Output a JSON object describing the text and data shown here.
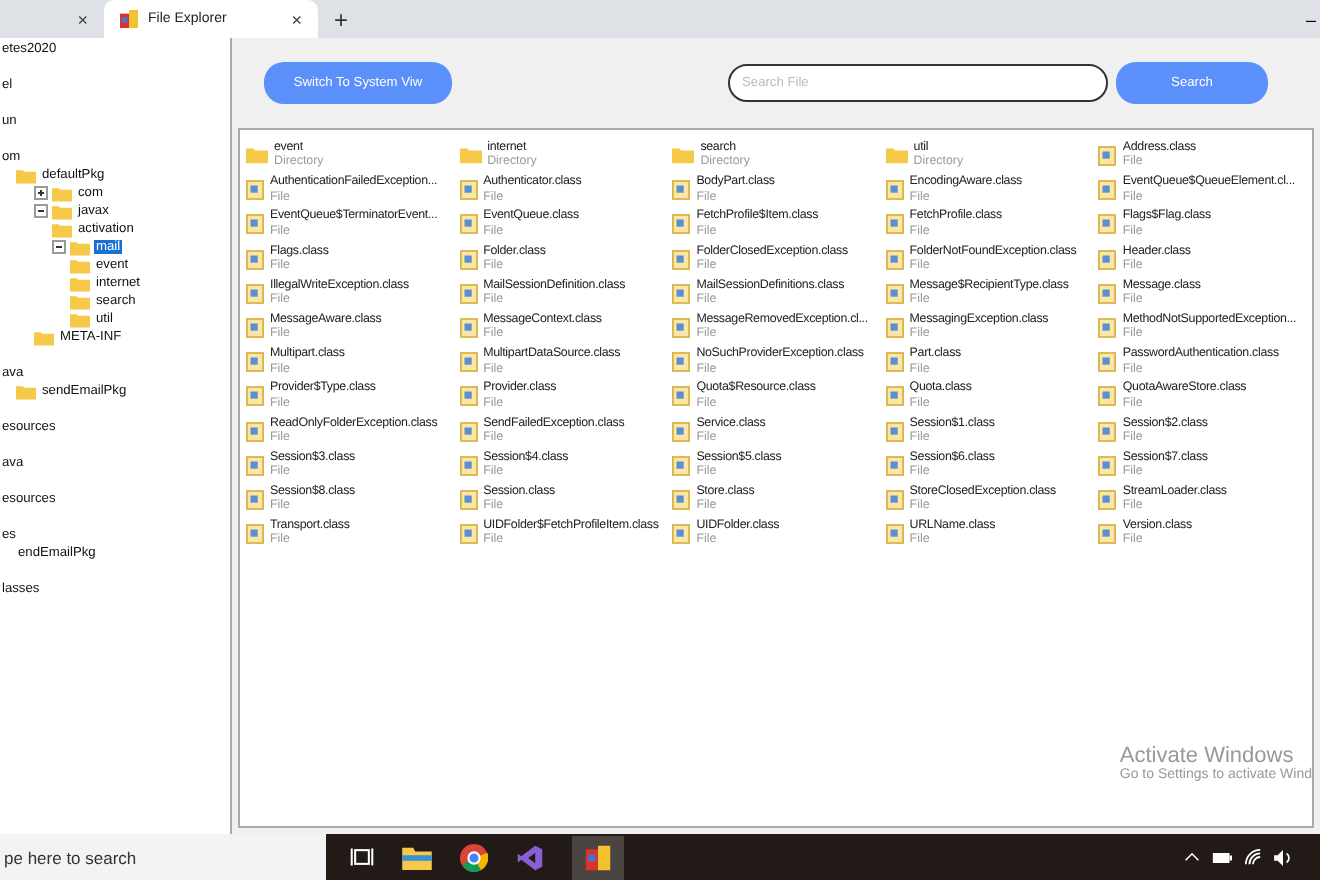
{
  "browser_tabs": [
    {
      "selected": false,
      "close": "×"
    },
    {
      "label": "File Explorer",
      "selected": true,
      "close": "×"
    }
  ],
  "new_tab": "+",
  "window_controls": {
    "minimize": "–"
  },
  "tree": [
    {
      "label": "etes2020",
      "selected": false
    },
    {
      "label": "el",
      "selected": false
    },
    {
      "label": "un",
      "selected": false
    },
    {
      "label": "om",
      "selected": false,
      "children": [
        {
          "label": "defaultPkg",
          "kind": "folder",
          "selected": false,
          "children": [
            {
              "label": "com",
              "kind": "folder",
              "selected": false,
              "expanded": false
            },
            {
              "label": "javax",
              "kind": "folder",
              "selected": false,
              "expanded": true,
              "children": [
                {
                  "label": "activation",
                  "kind": "folder",
                  "selected": false
                },
                {
                  "label": "mail",
                  "kind": "folder",
                  "selected": true,
                  "expanded": true,
                  "children": [
                    {
                      "label": "event",
                      "kind": "folder",
                      "selected": false
                    },
                    {
                      "label": "internet",
                      "kind": "folder",
                      "selected": false
                    },
                    {
                      "label": "search",
                      "kind": "folder",
                      "selected": false
                    },
                    {
                      "label": "util",
                      "kind": "folder",
                      "selected": false
                    }
                  ]
                }
              ]
            },
            {
              "label": "META-INF",
              "kind": "folder",
              "selected": false
            }
          ]
        }
      ]
    },
    {
      "label": "ava",
      "selected": false,
      "children": [
        {
          "label": "sendEmailPkg",
          "kind": "folder",
          "selected": false
        }
      ]
    },
    {
      "label": "esources",
      "selected": false
    },
    {
      "label": "ava",
      "selected": false
    },
    {
      "label": "esources",
      "selected": false
    },
    {
      "label": "es",
      "selected": false,
      "children": [
        {
          "label": "endEmailPkg",
          "selected": false
        }
      ]
    },
    {
      "label": "lasses",
      "selected": false
    }
  ],
  "toolbar": {
    "switch_button": "Switch To System Viw",
    "search": {
      "placeholder": "Search File"
    },
    "search_button": "Search"
  },
  "files": [
    {
      "name": "event",
      "type": "Directory",
      "kind": "directory"
    },
    {
      "name": "internet",
      "type": "Directory",
      "kind": "directory"
    },
    {
      "name": "search",
      "type": "Directory",
      "kind": "directory"
    },
    {
      "name": "util",
      "type": "Directory",
      "kind": "directory"
    },
    {
      "name": "Address.class",
      "type": "File",
      "kind": "file"
    },
    {
      "name": "AuthenticationFailedException...",
      "type": "File",
      "kind": "file"
    },
    {
      "name": "Authenticator.class",
      "type": "File",
      "kind": "file"
    },
    {
      "name": "BodyPart.class",
      "type": "File",
      "kind": "file"
    },
    {
      "name": "EncodingAware.class",
      "type": "File",
      "kind": "file"
    },
    {
      "name": "EventQueue$QueueElement.cl...",
      "type": "File",
      "kind": "file"
    },
    {
      "name": "EventQueue$TerminatorEvent...",
      "type": "File",
      "kind": "file"
    },
    {
      "name": "EventQueue.class",
      "type": "File",
      "kind": "file"
    },
    {
      "name": "FetchProfile$Item.class",
      "type": "File",
      "kind": "file"
    },
    {
      "name": "FetchProfile.class",
      "type": "File",
      "kind": "file"
    },
    {
      "name": "Flags$Flag.class",
      "type": "File",
      "kind": "file"
    },
    {
      "name": "Flags.class",
      "type": "File",
      "kind": "file"
    },
    {
      "name": "Folder.class",
      "type": "File",
      "kind": "file"
    },
    {
      "name": "FolderClosedException.class",
      "type": "File",
      "kind": "file"
    },
    {
      "name": "FolderNotFoundException.class",
      "type": "File",
      "kind": "file"
    },
    {
      "name": "Header.class",
      "type": "File",
      "kind": "file"
    },
    {
      "name": "IllegalWriteException.class",
      "type": "File",
      "kind": "file"
    },
    {
      "name": "MailSessionDefinition.class",
      "type": "File",
      "kind": "file"
    },
    {
      "name": "MailSessionDefinitions.class",
      "type": "File",
      "kind": "file"
    },
    {
      "name": "Message$RecipientType.class",
      "type": "File",
      "kind": "file"
    },
    {
      "name": "Message.class",
      "type": "File",
      "kind": "file"
    },
    {
      "name": "MessageAware.class",
      "type": "File",
      "kind": "file"
    },
    {
      "name": "MessageContext.class",
      "type": "File",
      "kind": "file"
    },
    {
      "name": "MessageRemovedException.cl...",
      "type": "File",
      "kind": "file"
    },
    {
      "name": "MessagingException.class",
      "type": "File",
      "kind": "file"
    },
    {
      "name": "MethodNotSupportedException...",
      "type": "File",
      "kind": "file"
    },
    {
      "name": "Multipart.class",
      "type": "File",
      "kind": "file"
    },
    {
      "name": "MultipartDataSource.class",
      "type": "File",
      "kind": "file"
    },
    {
      "name": "NoSuchProviderException.class",
      "type": "File",
      "kind": "file"
    },
    {
      "name": "Part.class",
      "type": "File",
      "kind": "file"
    },
    {
      "name": "PasswordAuthentication.class",
      "type": "File",
      "kind": "file"
    },
    {
      "name": "Provider$Type.class",
      "type": "File",
      "kind": "file"
    },
    {
      "name": "Provider.class",
      "type": "File",
      "kind": "file"
    },
    {
      "name": "Quota$Resource.class",
      "type": "File",
      "kind": "file"
    },
    {
      "name": "Quota.class",
      "type": "File",
      "kind": "file"
    },
    {
      "name": "QuotaAwareStore.class",
      "type": "File",
      "kind": "file"
    },
    {
      "name": "ReadOnlyFolderException.class",
      "type": "File",
      "kind": "file"
    },
    {
      "name": "SendFailedException.class",
      "type": "File",
      "kind": "file"
    },
    {
      "name": "Service.class",
      "type": "File",
      "kind": "file"
    },
    {
      "name": "Session$1.class",
      "type": "File",
      "kind": "file"
    },
    {
      "name": "Session$2.class",
      "type": "File",
      "kind": "file"
    },
    {
      "name": "Session$3.class",
      "type": "File",
      "kind": "file"
    },
    {
      "name": "Session$4.class",
      "type": "File",
      "kind": "file"
    },
    {
      "name": "Session$5.class",
      "type": "File",
      "kind": "file"
    },
    {
      "name": "Session$6.class",
      "type": "File",
      "kind": "file"
    },
    {
      "name": "Session$7.class",
      "type": "File",
      "kind": "file"
    },
    {
      "name": "Session$8.class",
      "type": "File",
      "kind": "file"
    },
    {
      "name": "Session.class",
      "type": "File",
      "kind": "file"
    },
    {
      "name": "Store.class",
      "type": "File",
      "kind": "file"
    },
    {
      "name": "StoreClosedException.class",
      "type": "File",
      "kind": "file"
    },
    {
      "name": "StreamLoader.class",
      "type": "File",
      "kind": "file"
    },
    {
      "name": "Transport.class",
      "type": "File",
      "kind": "file"
    },
    {
      "name": "UIDFolder$FetchProfileItem.class",
      "type": "File",
      "kind": "file"
    },
    {
      "name": "UIDFolder.class",
      "type": "File",
      "kind": "file"
    },
    {
      "name": "URLName.class",
      "type": "File",
      "kind": "file"
    },
    {
      "name": "Version.class",
      "type": "File",
      "kind": "file"
    }
  ],
  "activation_notice": {
    "title": "Activate Windows",
    "text": "Go to Settings to activate Wind"
  },
  "taskbar": {
    "search": {
      "placeholder": "pe here to search"
    }
  }
}
